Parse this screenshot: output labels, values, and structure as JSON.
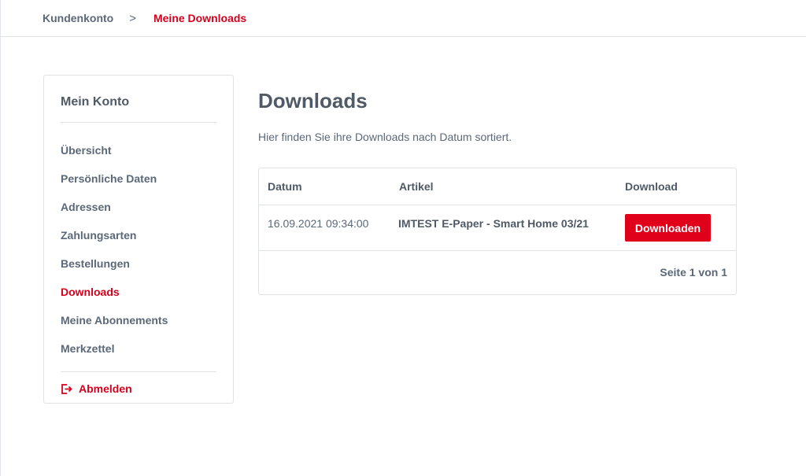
{
  "breadcrumb": {
    "items": [
      "Kundenkonto",
      "Meine Downloads"
    ],
    "separator": ">"
  },
  "sidebar": {
    "title": "Mein Konto",
    "items": [
      {
        "label": "Übersicht",
        "active": false
      },
      {
        "label": "Persönliche Daten",
        "active": false
      },
      {
        "label": "Adressen",
        "active": false
      },
      {
        "label": "Zahlungsarten",
        "active": false
      },
      {
        "label": "Bestellungen",
        "active": false
      },
      {
        "label": "Downloads",
        "active": true
      },
      {
        "label": "Meine Abonnements",
        "active": false
      },
      {
        "label": "Merkzettel",
        "active": false
      }
    ],
    "logout": {
      "label": "Abmelden",
      "icon": "logout-icon"
    }
  },
  "main": {
    "title": "Downloads",
    "intro": "Hier finden Sie ihre Downloads nach Datum sortiert.",
    "table": {
      "columns": [
        "Datum",
        "Artikel",
        "Download"
      ],
      "rows": [
        {
          "date": "16.09.2021 09:34:00",
          "article": "IMTEST E-Paper - Smart Home 03/21",
          "action": "Downloaden"
        }
      ],
      "pagination": "Seite 1 von 1"
    }
  },
  "colors": {
    "accent": "#d6001c",
    "button": "#e1001a",
    "text": "#5b6878",
    "border": "#dfe3e7"
  }
}
